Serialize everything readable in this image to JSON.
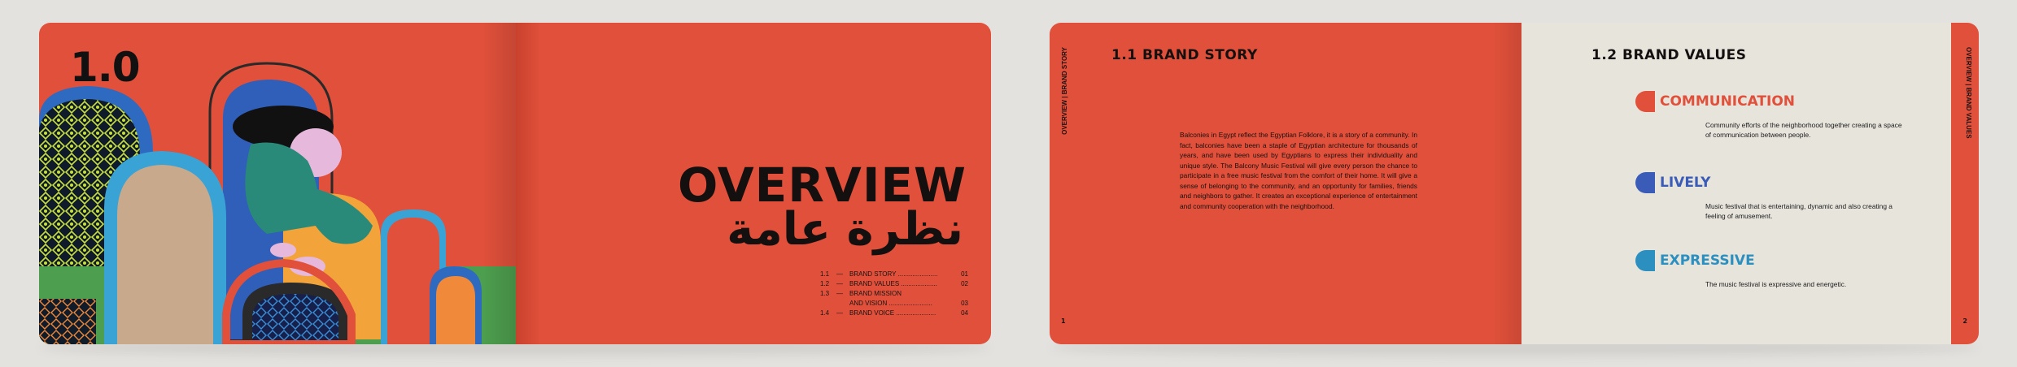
{
  "book1": {
    "chapter_number": "1.0",
    "title": "OVERVIEW",
    "title_arabic": "نظرة عامة",
    "toc": [
      {
        "num": "1.1",
        "label": "BRAND STORY",
        "page": "01"
      },
      {
        "num": "1.2",
        "label": "BRAND VALUES",
        "page": "02"
      },
      {
        "num": "1.3",
        "label": "BRAND MISSION",
        "page": ""
      },
      {
        "num": "",
        "label": "AND VISION",
        "page": "03"
      },
      {
        "num": "1.4",
        "label": "BRAND VOICE",
        "page": "04"
      }
    ]
  },
  "book2": {
    "spine_tab_left": "OVERVIEW | BRAND STORY",
    "spine_tab_right": "OVERVIEW | BRAND VALUES",
    "page_left": "1",
    "page_right": "2",
    "story_title": "1.1 BRAND STORY",
    "story_text": "Balconies in Egypt reflect the Egyptian Folklore, it is a story of a community. In fact, balconies have been a staple of Egyptian architecture for thousands of years, and have been used by Egyptians to express their individuality and unique style. The Balcony Music Festival will give every person the chance to participate in a free music festival from the comfort of their home. It will give a sense of belonging to the community, and an opportunity for families, friends and neighbors to gather. It creates an exceptional experience of entertainment and community cooperation with the neighborhood.",
    "values_title": "1.2 BRAND VALUES",
    "values": [
      {
        "name": "COMMUNICATION",
        "desc": "Community efforts of the neighborhood together creating a space of communication between people.",
        "color": "#e0503a"
      },
      {
        "name": "LIVELY",
        "desc": "Music festival that is entertaining, dynamic and also creating a feeling of amusement.",
        "color": "#3b5bb8"
      },
      {
        "name": "EXPRESSIVE",
        "desc": "The music festival is expressive and energetic.",
        "color": "#2b8fc0"
      }
    ]
  },
  "colors": {
    "accent_red": "#e0503a",
    "cream": "#e7e4dc",
    "ink": "#141010"
  }
}
